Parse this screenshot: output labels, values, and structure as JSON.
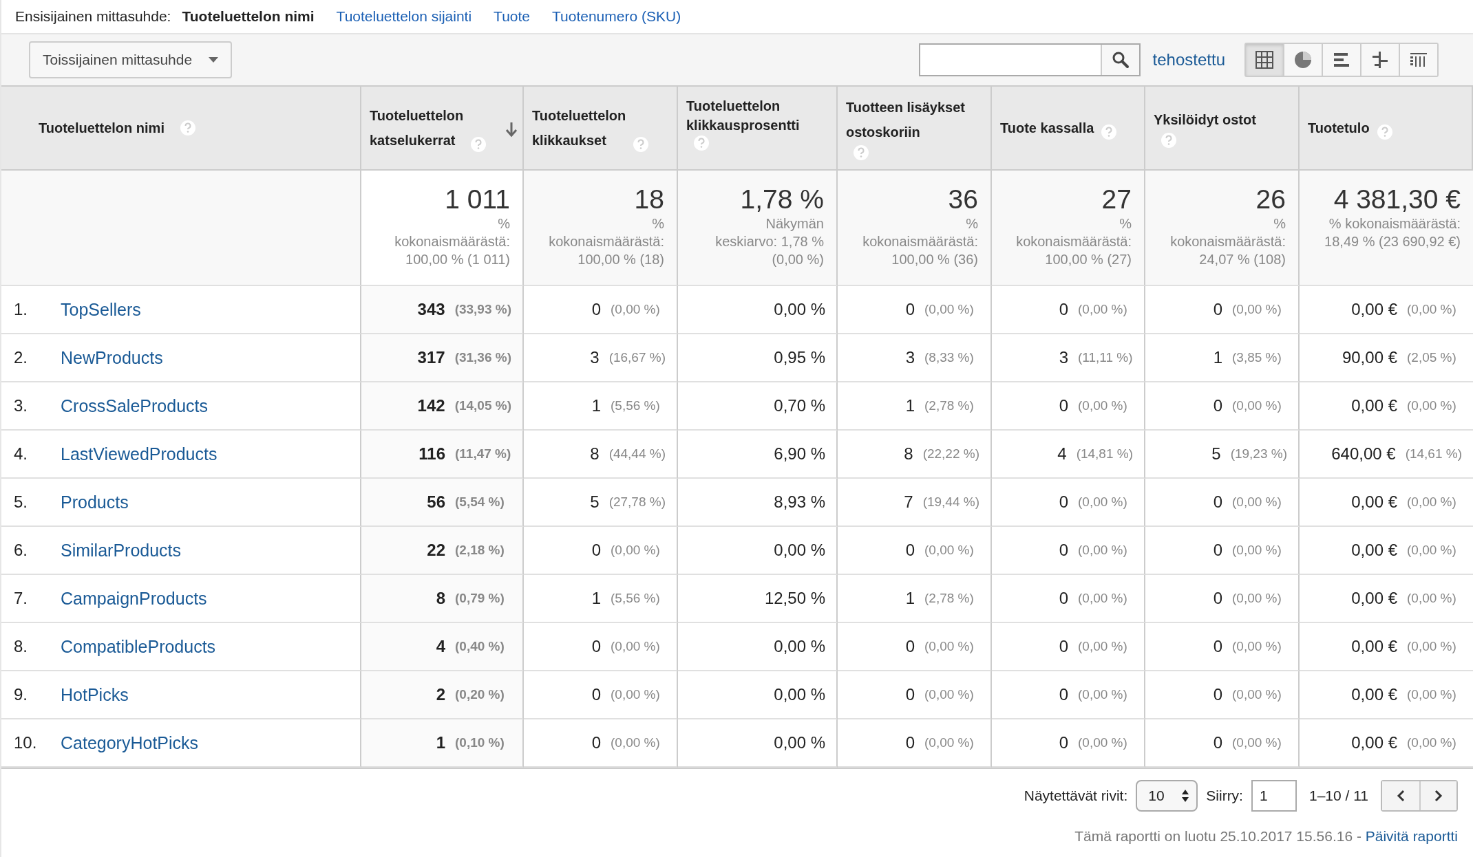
{
  "dimension_bar": {
    "label": "Ensisijainen mittasuhde:",
    "options": [
      {
        "label": "Tuoteluettelon nimi",
        "selected": true
      },
      {
        "label": "Tuoteluettelon sijainti",
        "selected": false
      },
      {
        "label": "Tuote",
        "selected": false
      },
      {
        "label": "Tuotenumero (SKU)",
        "selected": false
      }
    ]
  },
  "toolbar": {
    "secondary_dimension": "Toissijainen mittasuhde",
    "advanced_link": "tehostettu",
    "views": [
      {
        "kind": "table",
        "selected": true
      },
      {
        "kind": "pie",
        "selected": false
      },
      {
        "kind": "bars",
        "selected": false
      },
      {
        "kind": "comparison",
        "selected": false
      },
      {
        "kind": "pivot",
        "selected": false
      }
    ]
  },
  "table": {
    "dimension_column": {
      "label": "Tuoteluettelon nimi"
    },
    "columns": [
      {
        "label": "Tuoteluettelon katselukerrat",
        "sorted": true
      },
      {
        "label": "Tuoteluettelon klikkaukset",
        "sorted": false
      },
      {
        "label": "Tuoteluettelon klikkausprosentti",
        "sorted": false
      },
      {
        "label": "Tuotteen lisäykset ostoskoriin",
        "sorted": false
      },
      {
        "label": "Tuote kassalla",
        "sorted": false
      },
      {
        "label": "Yksilöidyt ostot",
        "sorted": false
      },
      {
        "label": "Tuotetulo",
        "sorted": false
      }
    ],
    "totals": [
      {
        "value": "1 011",
        "note": "% kokonaismäärästä: 100,00 % (1 011)"
      },
      {
        "value": "18",
        "note": "% kokonaismäärästä: 100,00 % (18)"
      },
      {
        "value": "1,78 %",
        "note": "Näkymän keskiarvo: 1,78 % (0,00 %)"
      },
      {
        "value": "36",
        "note": "% kokonaismäärästä: 100,00 % (36)"
      },
      {
        "value": "27",
        "note": "% kokonaismäärästä: 100,00 % (27)"
      },
      {
        "value": "26",
        "note": "% kokonaismäärästä: 24,07 % (108)"
      },
      {
        "value": "4 381,30 €",
        "note": "% kokonaismäärästä: 18,49 % (23 690,92 €)"
      }
    ],
    "rows": [
      {
        "rank": "1.",
        "name": "TopSellers",
        "cells": [
          {
            "value": "343",
            "share": "(33,93 %)"
          },
          {
            "value": "0",
            "share": "(0,00 %)"
          },
          {
            "value": "0,00 %"
          },
          {
            "value": "0",
            "share": "(0,00 %)"
          },
          {
            "value": "0",
            "share": "(0,00 %)"
          },
          {
            "value": "0",
            "share": "(0,00 %)"
          },
          {
            "value": "0,00 €",
            "share": "(0,00 %)"
          }
        ]
      },
      {
        "rank": "2.",
        "name": "NewProducts",
        "cells": [
          {
            "value": "317",
            "share": "(31,36 %)"
          },
          {
            "value": "3",
            "share": "(16,67 %)"
          },
          {
            "value": "0,95 %"
          },
          {
            "value": "3",
            "share": "(8,33 %)"
          },
          {
            "value": "3",
            "share": "(11,11 %)"
          },
          {
            "value": "1",
            "share": "(3,85 %)"
          },
          {
            "value": "90,00 €",
            "share": "(2,05 %)"
          }
        ]
      },
      {
        "rank": "3.",
        "name": "CrossSaleProducts",
        "cells": [
          {
            "value": "142",
            "share": "(14,05 %)"
          },
          {
            "value": "1",
            "share": "(5,56 %)"
          },
          {
            "value": "0,70 %"
          },
          {
            "value": "1",
            "share": "(2,78 %)"
          },
          {
            "value": "0",
            "share": "(0,00 %)"
          },
          {
            "value": "0",
            "share": "(0,00 %)"
          },
          {
            "value": "0,00 €",
            "share": "(0,00 %)"
          }
        ]
      },
      {
        "rank": "4.",
        "name": "LastViewedProducts",
        "cells": [
          {
            "value": "116",
            "share": "(11,47 %)"
          },
          {
            "value": "8",
            "share": "(44,44 %)"
          },
          {
            "value": "6,90 %"
          },
          {
            "value": "8",
            "share": "(22,22 %)"
          },
          {
            "value": "4",
            "share": "(14,81 %)"
          },
          {
            "value": "5",
            "share": "(19,23 %)"
          },
          {
            "value": "640,00 €",
            "share": "(14,61 %)"
          }
        ]
      },
      {
        "rank": "5.",
        "name": "Products",
        "cells": [
          {
            "value": "56",
            "share": "(5,54 %)"
          },
          {
            "value": "5",
            "share": "(27,78 %)"
          },
          {
            "value": "8,93 %"
          },
          {
            "value": "7",
            "share": "(19,44 %)"
          },
          {
            "value": "0",
            "share": "(0,00 %)"
          },
          {
            "value": "0",
            "share": "(0,00 %)"
          },
          {
            "value": "0,00 €",
            "share": "(0,00 %)"
          }
        ]
      },
      {
        "rank": "6.",
        "name": "SimilarProducts",
        "cells": [
          {
            "value": "22",
            "share": "(2,18 %)"
          },
          {
            "value": "0",
            "share": "(0,00 %)"
          },
          {
            "value": "0,00 %"
          },
          {
            "value": "0",
            "share": "(0,00 %)"
          },
          {
            "value": "0",
            "share": "(0,00 %)"
          },
          {
            "value": "0",
            "share": "(0,00 %)"
          },
          {
            "value": "0,00 €",
            "share": "(0,00 %)"
          }
        ]
      },
      {
        "rank": "7.",
        "name": "CampaignProducts",
        "cells": [
          {
            "value": "8",
            "share": "(0,79 %)"
          },
          {
            "value": "1",
            "share": "(5,56 %)"
          },
          {
            "value": "12,50 %"
          },
          {
            "value": "1",
            "share": "(2,78 %)"
          },
          {
            "value": "0",
            "share": "(0,00 %)"
          },
          {
            "value": "0",
            "share": "(0,00 %)"
          },
          {
            "value": "0,00 €",
            "share": "(0,00 %)"
          }
        ]
      },
      {
        "rank": "8.",
        "name": "CompatibleProducts",
        "cells": [
          {
            "value": "4",
            "share": "(0,40 %)"
          },
          {
            "value": "0",
            "share": "(0,00 %)"
          },
          {
            "value": "0,00 %"
          },
          {
            "value": "0",
            "share": "(0,00 %)"
          },
          {
            "value": "0",
            "share": "(0,00 %)"
          },
          {
            "value": "0",
            "share": "(0,00 %)"
          },
          {
            "value": "0,00 €",
            "share": "(0,00 %)"
          }
        ]
      },
      {
        "rank": "9.",
        "name": "HotPicks",
        "cells": [
          {
            "value": "2",
            "share": "(0,20 %)"
          },
          {
            "value": "0",
            "share": "(0,00 %)"
          },
          {
            "value": "0,00 %"
          },
          {
            "value": "0",
            "share": "(0,00 %)"
          },
          {
            "value": "0",
            "share": "(0,00 %)"
          },
          {
            "value": "0",
            "share": "(0,00 %)"
          },
          {
            "value": "0,00 €",
            "share": "(0,00 %)"
          }
        ]
      },
      {
        "rank": "10.",
        "name": "CategoryHotPicks",
        "cells": [
          {
            "value": "1",
            "share": "(0,10 %)"
          },
          {
            "value": "0",
            "share": "(0,00 %)"
          },
          {
            "value": "0,00 %"
          },
          {
            "value": "0",
            "share": "(0,00 %)"
          },
          {
            "value": "0",
            "share": "(0,00 %)"
          },
          {
            "value": "0",
            "share": "(0,00 %)"
          },
          {
            "value": "0,00 €",
            "share": "(0,00 %)"
          }
        ]
      }
    ]
  },
  "pagination": {
    "rows_label": "Näytettävät rivit:",
    "rows_value": "10",
    "goto_label": "Siirry:",
    "goto_value": "1",
    "range": "1–10 / 11"
  },
  "footer": {
    "text": "Tämä raportti on luotu 25.10.2017 15.56.16 - ",
    "link": "Päivitä raportti"
  }
}
